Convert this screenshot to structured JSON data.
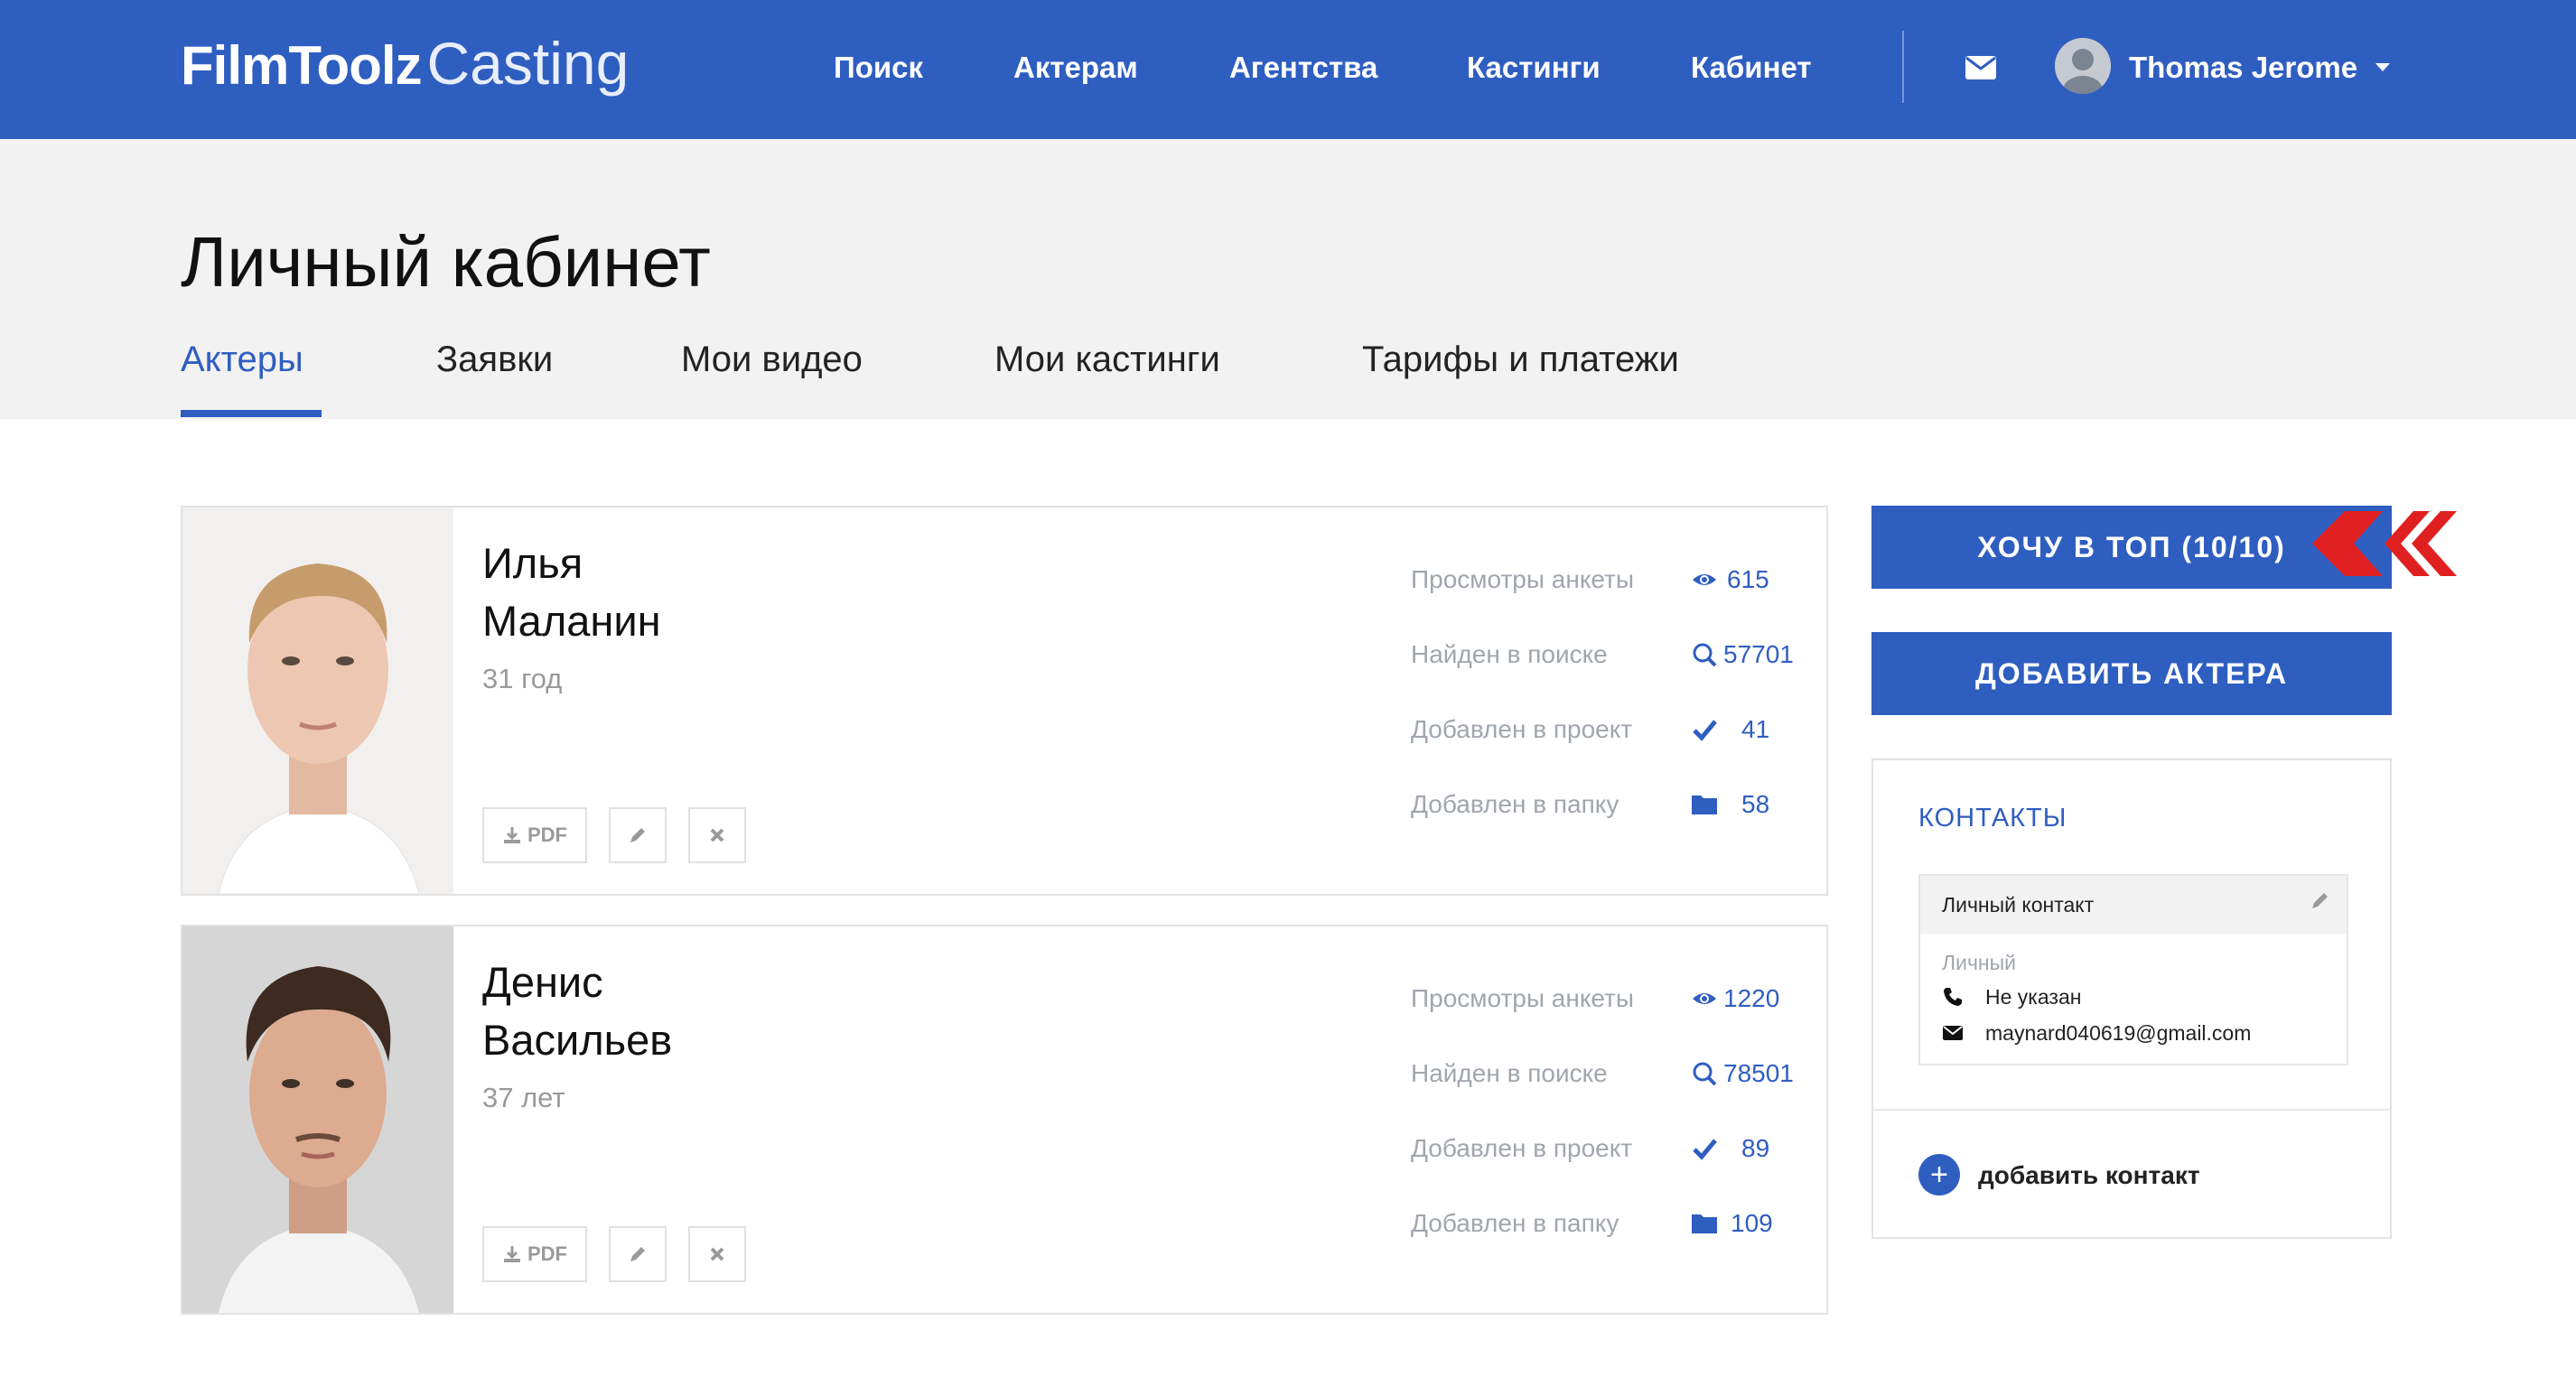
{
  "header": {
    "logo_bold": "FilmToolz",
    "logo_thin": "Casting",
    "nav": [
      "Поиск",
      "Актерам",
      "Агентства",
      "Кастинги",
      "Кабинет"
    ],
    "user_name": "Thomas Jerome",
    "mail_icon": "envelope-icon",
    "dropdown_icon": "caret-down-icon"
  },
  "page": {
    "title": "Личный кабинет",
    "tabs": [
      "Актеры",
      "Заявки",
      "Мои видео",
      "Мои кастинги",
      "Тарифы и платежи"
    ],
    "active_tab": "Актеры"
  },
  "actors": [
    {
      "first_name": "Илья",
      "last_name": "Маланин",
      "age": "31 год",
      "pdf_label": "PDF",
      "stats": [
        {
          "label": "Просмотры анкеты",
          "icon": "eye-icon",
          "value": "615"
        },
        {
          "label": "Найден в поиске",
          "icon": "search-icon",
          "value": "57701"
        },
        {
          "label": "Добавлен в проект",
          "icon": "check-icon",
          "value": "41"
        },
        {
          "label": "Добавлен в папку",
          "icon": "folder-icon",
          "value": "58"
        }
      ]
    },
    {
      "first_name": "Денис",
      "last_name": "Васильев",
      "age": "37 лет",
      "pdf_label": "PDF",
      "stats": [
        {
          "label": "Просмотры анкеты",
          "icon": "eye-icon",
          "value": "1220"
        },
        {
          "label": "Найден в поиске",
          "icon": "search-icon",
          "value": "78501"
        },
        {
          "label": "Добавлен в проект",
          "icon": "check-icon",
          "value": "89"
        },
        {
          "label": "Добавлен в папку",
          "icon": "folder-icon",
          "value": "109"
        }
      ]
    }
  ],
  "sidebar": {
    "top_button": "ХОЧУ В ТОП (10/10)",
    "add_actor_button": "ДОБАВИТЬ АКТЕРА",
    "contacts": {
      "title": "КОНТАКТЫ",
      "card_title": "Личный контакт",
      "type": "Личный",
      "phone": "Не указан",
      "email": "maynard040619@gmail.com",
      "add_label": "добавить контакт"
    }
  },
  "colors": {
    "brand": "#2f5ec1",
    "accent_arrow": "#e02020",
    "subheader_bg": "#f2f2f2",
    "muted_text": "#a0a6ad"
  }
}
